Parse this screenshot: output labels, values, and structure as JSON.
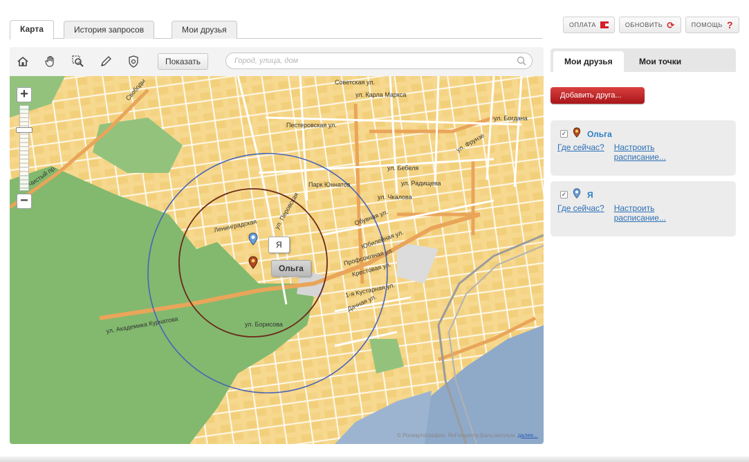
{
  "tabs": [
    {
      "label": "Карта",
      "active": true
    },
    {
      "label": "История запросов",
      "active": false
    },
    {
      "label": "Мои друзья",
      "active": false
    }
  ],
  "top_buttons": {
    "pay": "ОПЛАТА",
    "refresh": "ОБНОВИТЬ",
    "help": "ПОМОЩЬ"
  },
  "toolbar": {
    "show_label": "Показать",
    "search_placeholder": "Город, улица, дом"
  },
  "map": {
    "streets": [
      "Советская ул.",
      "ул. Карла Маркса",
      "ул. Богдана",
      "Пестеровская ул.",
      "ул. Фрунзе",
      "ул. Бебеля",
      "ул. Радищева",
      "Парк Юннатов",
      "ул. Чкалова",
      "Ленинградская",
      "ул. Перовская",
      "Обувная ул.",
      "Юбилейная ул.",
      "Профсоюзная ул.",
      "Крестовая ул.",
      "1-я Кустарная ул.",
      "Дачная ул.",
      "ул. Борисова",
      "ул. Академика Курчатова",
      "Свободы",
      "Чистый пр."
    ],
    "markers": [
      {
        "label": "Я"
      },
      {
        "label": "Ольга"
      }
    ],
    "copyright_text": "© Роскартография, ЯнГеоцентр-Бальзапольм,",
    "copyright_link": "далее..."
  },
  "right_panel": {
    "tabs": [
      {
        "label": "Мои друзья",
        "active": true
      },
      {
        "label": "Мои точки",
        "active": false
      }
    ],
    "add_button": "Добавить друга...",
    "friends": [
      {
        "name": "Ольга",
        "where": "Где сейчас?",
        "schedule": "Настроить расписание..."
      },
      {
        "name": "Я",
        "where": "Где сейчас?",
        "schedule": "Настроить расписание..."
      }
    ]
  },
  "colors": {
    "accent_red": "#d31f2a",
    "link_blue": "#2a6fb5",
    "map_yellow": "#f6d88e",
    "park_green": "#82b96e",
    "river_blue": "#8fa9c9",
    "circle_blue": "#4a63b8",
    "circle_brown": "#6b2a1a"
  }
}
